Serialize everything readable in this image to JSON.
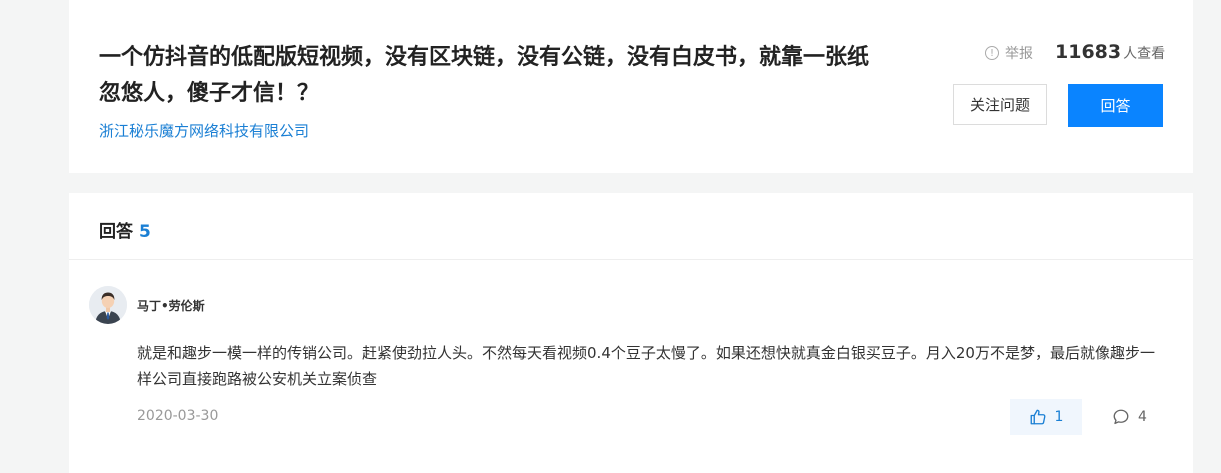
{
  "question": {
    "title": "一个仿抖音的低配版短视频，没有区块链，没有公链，没有白皮书，就靠一张纸忽悠人，傻子才信！？",
    "company": "浙江秘乐魔方网络科技有限公司",
    "report_label": "举报",
    "view_count": "11683",
    "view_suffix": "人查看",
    "follow_label": "关注问题",
    "answer_label": "回答"
  },
  "answers": {
    "header_label": "回答",
    "count": "5",
    "items": [
      {
        "author": "马丁•劳伦斯",
        "body": "就是和趣步一模一样的传销公司。赶紧使劲拉人头。不然每天看视频0.4个豆子太慢了。如果还想快就真金白银买豆子。月入20万不是梦，最后就像趣步一样公司直接跑路被公安机关立案侦查",
        "date": "2020-03-30",
        "likes": "1",
        "comments": "4"
      }
    ]
  },
  "colors": {
    "accent": "#0a84ff",
    "link": "#1a7fd4",
    "background": "#f4f5f5"
  },
  "icons": [
    "info-circle-icon",
    "thumbs-up-icon",
    "comment-icon",
    "avatar-icon"
  ]
}
